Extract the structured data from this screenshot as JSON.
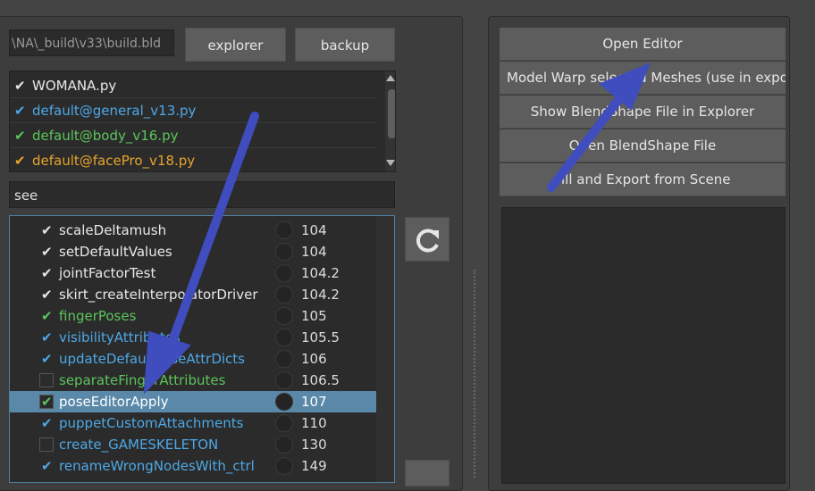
{
  "toolbar": {
    "build_path": "\\NA\\_build\\v33\\build.bld",
    "explorer_label": "explorer",
    "backup_label": "backup"
  },
  "files": [
    {
      "name": "WOMANA.py",
      "check": "✔",
      "color": "#e8e8e8"
    },
    {
      "name": "default@general_v13.py",
      "check": "✔",
      "color": "#4ea8e6"
    },
    {
      "name": "default@body_v16.py",
      "check": "✔",
      "color": "#5cc45c"
    },
    {
      "name": "default@facePro_v18.py",
      "check": "✔",
      "color": "#e6a42c"
    }
  ],
  "search": {
    "value": "see"
  },
  "scripts": [
    {
      "name": "scaleDeltamush",
      "value": "104",
      "check": "✔",
      "color": "#e8e8e8"
    },
    {
      "name": "setDefaultValues",
      "value": "104",
      "check": "✔",
      "color": "#e8e8e8"
    },
    {
      "name": "jointFactorTest",
      "value": "104.2",
      "check": "✔",
      "color": "#e8e8e8"
    },
    {
      "name": "skirt_createInterpolatorDriver",
      "value": "104.2",
      "check": "✔",
      "color": "#e8e8e8"
    },
    {
      "name": "fingerPoses",
      "value": "105",
      "check": "✔",
      "color": "#5cc45c"
    },
    {
      "name": "visibilityAttributes",
      "value": "105.5",
      "check": "✔",
      "color": "#4ea8e6"
    },
    {
      "name": "updateDefaultPoseAttrDicts",
      "value": "106",
      "check": "✔",
      "color": "#4ea8e6"
    },
    {
      "name": "separateFingerAttributes",
      "value": "106.5",
      "check": "",
      "color": "#5cc45c"
    },
    {
      "name": "poseEditorApply",
      "value": "107",
      "check": "✔",
      "color": "#ffffff",
      "selected": true
    },
    {
      "name": "puppetCustomAttachments",
      "value": "110",
      "check": "✔",
      "color": "#4ea8e6"
    },
    {
      "name": "create_GAMESKELETON",
      "value": "130",
      "check": "",
      "color": "#4ea8e6"
    },
    {
      "name": "renameWrongNodesWith_ctrl",
      "value": "149",
      "check": "✔",
      "color": "#4ea8e6"
    }
  ],
  "actions": {
    "open_editor": "Open Editor",
    "model_warp": "Model Warp selected Meshes (use in exported",
    "show_blendshape": "Show BlendShape File in Explorer",
    "open_blendshape": "Open BlendShape File",
    "fill_export": "Fill and Export from Scene"
  },
  "icons": {
    "refresh": "refresh-icon",
    "annotation": "arrow-annotation-icon"
  },
  "colors": {
    "selection": "#5a88a8",
    "annotation_arrow": "#3f4dbf"
  }
}
